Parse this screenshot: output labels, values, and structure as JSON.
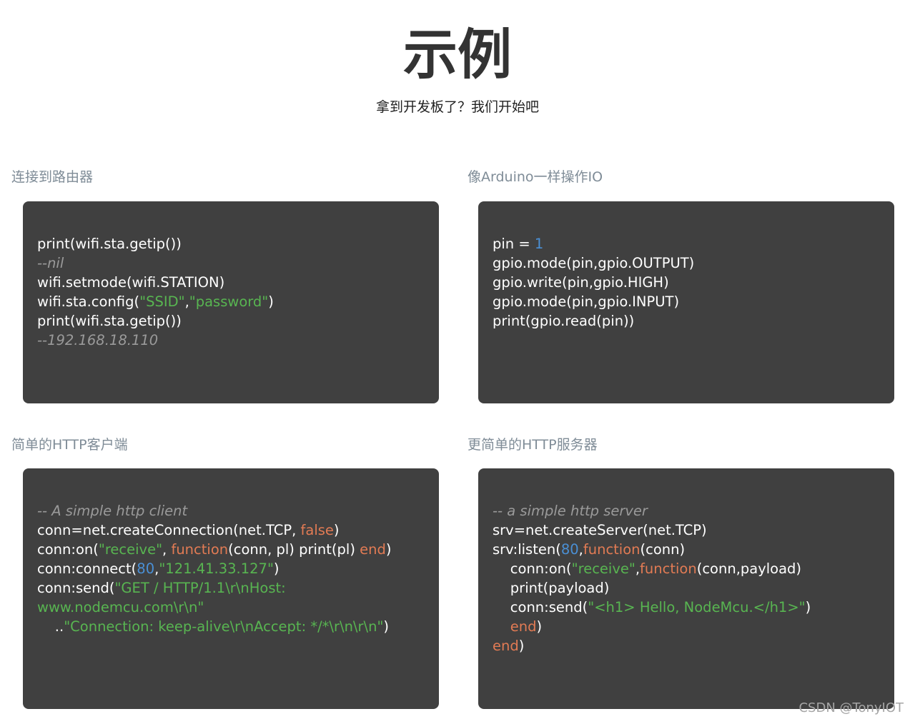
{
  "header": {
    "title": "示例",
    "subtitle": "拿到开发板了？我们开始吧"
  },
  "sections": [
    {
      "heading": "连接到路由器",
      "code": [
        [
          {
            "t": "print(wifi.sta.getip())",
            "c": "p"
          }
        ],
        [
          {
            "t": "--nil",
            "c": "c"
          }
        ],
        [
          {
            "t": "wifi.setmode(wifi.STATION)",
            "c": "p"
          }
        ],
        [
          {
            "t": "wifi.sta.config(",
            "c": "p"
          },
          {
            "t": "\"SSID\"",
            "c": "s"
          },
          {
            "t": ",",
            "c": "p"
          },
          {
            "t": "\"password\"",
            "c": "s"
          },
          {
            "t": ")",
            "c": "p"
          }
        ],
        [
          {
            "t": "print(wifi.sta.getip())",
            "c": "p"
          }
        ],
        [
          {
            "t": "--192.168.18.110",
            "c": "c"
          }
        ]
      ]
    },
    {
      "heading": "像Arduino一样操作IO",
      "code": [
        [
          {
            "t": "pin = ",
            "c": "p"
          },
          {
            "t": "1",
            "c": "n"
          }
        ],
        [
          {
            "t": "gpio.mode(pin,gpio.OUTPUT)",
            "c": "p"
          }
        ],
        [
          {
            "t": "gpio.write(pin,gpio.HIGH)",
            "c": "p"
          }
        ],
        [
          {
            "t": "gpio.mode(pin,gpio.INPUT)",
            "c": "p"
          }
        ],
        [
          {
            "t": "print(gpio.read(pin))",
            "c": "p"
          }
        ]
      ]
    },
    {
      "heading": "简单的HTTP客户端",
      "code": [
        [
          {
            "t": "-- A simple http client",
            "c": "c"
          }
        ],
        [
          {
            "t": "conn=net.createConnection(net.TCP, ",
            "c": "p"
          },
          {
            "t": "false",
            "c": "k"
          },
          {
            "t": ")",
            "c": "p"
          }
        ],
        [
          {
            "t": "conn:on(",
            "c": "p"
          },
          {
            "t": "\"receive\"",
            "c": "s"
          },
          {
            "t": ", ",
            "c": "p"
          },
          {
            "t": "function",
            "c": "k"
          },
          {
            "t": "(conn, pl) print(pl) ",
            "c": "p"
          },
          {
            "t": "end",
            "c": "k"
          },
          {
            "t": ")",
            "c": "p"
          }
        ],
        [
          {
            "t": "conn:connect(",
            "c": "p"
          },
          {
            "t": "80",
            "c": "n"
          },
          {
            "t": ",",
            "c": "p"
          },
          {
            "t": "\"121.41.33.127\"",
            "c": "s"
          },
          {
            "t": ")",
            "c": "p"
          }
        ],
        [
          {
            "t": "conn:send(",
            "c": "p"
          },
          {
            "t": "\"GET / HTTP/1.1\\r\\nHost:",
            "c": "s"
          }
        ],
        [
          {
            "t": "www.nodemcu.com\\r\\n\"",
            "c": "s"
          }
        ],
        [
          {
            "t": "    ..",
            "c": "p"
          },
          {
            "t": "\"Connection: keep-alive\\r\\nAccept: */*\\r\\n\\r\\n\"",
            "c": "s"
          },
          {
            "t": ")",
            "c": "p"
          }
        ]
      ]
    },
    {
      "heading": "更简单的HTTP服务器",
      "code": [
        [
          {
            "t": "-- a simple http server",
            "c": "c"
          }
        ],
        [
          {
            "t": "srv=net.createServer(net.TCP)",
            "c": "p"
          }
        ],
        [
          {
            "t": "srv:listen(",
            "c": "p"
          },
          {
            "t": "80",
            "c": "n"
          },
          {
            "t": ",",
            "c": "p"
          },
          {
            "t": "function",
            "c": "k"
          },
          {
            "t": "(conn)",
            "c": "p"
          }
        ],
        [
          {
            "t": "    conn:on(",
            "c": "p"
          },
          {
            "t": "\"receive\"",
            "c": "s"
          },
          {
            "t": ",",
            "c": "p"
          },
          {
            "t": "function",
            "c": "k"
          },
          {
            "t": "(conn,payload)",
            "c": "p"
          }
        ],
        [
          {
            "t": "    print(payload)",
            "c": "p"
          }
        ],
        [
          {
            "t": "    conn:send(",
            "c": "p"
          },
          {
            "t": "\"<h1> Hello, NodeMcu.</h1>\"",
            "c": "s"
          },
          {
            "t": ")",
            "c": "p"
          }
        ],
        [
          {
            "t": "    ",
            "c": "p"
          },
          {
            "t": "end",
            "c": "k"
          },
          {
            "t": ")",
            "c": "p"
          }
        ],
        [
          {
            "t": "end",
            "c": "k"
          },
          {
            "t": ")",
            "c": "p"
          }
        ]
      ]
    }
  ],
  "watermark": "CSDN @TonyIOT",
  "colors": {
    "code_background": "#404040",
    "code_text": "#ffffff",
    "comment": "#9a9a9a",
    "string": "#58b551",
    "number": "#4a90d6",
    "keyword": "#e27b54",
    "heading": "#7f8c97"
  }
}
